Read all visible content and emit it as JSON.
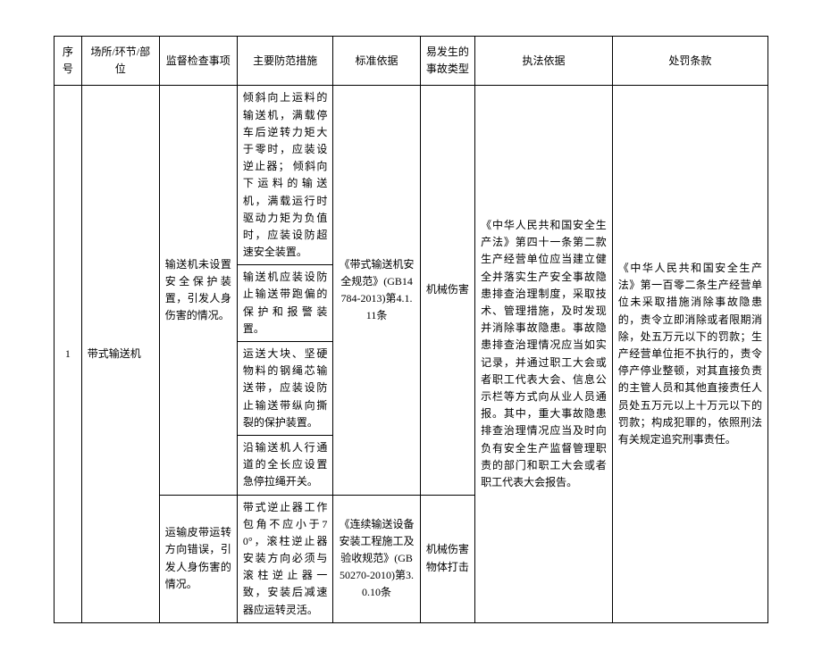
{
  "headers": {
    "seq": "序号",
    "place": "场所/环节/部位",
    "inspect": "监督检查事项",
    "measure": "主要防范措施",
    "standard": "标准依据",
    "accident": "易发生的事故类型",
    "law": "执法依据",
    "penalty": "处罚条款"
  },
  "row": {
    "seq": "1",
    "place": "带式输送机",
    "inspect1": "输送机未设置安全保护装置，引发人身伤害的情况。",
    "measures1": [
      "倾斜向上运料的输送机，满载停车后逆转力矩大于零时，应装设逆止器；\n倾斜向下运料的输送机，满载运行时驱动力矩为负值时，应装设防超速安全装置。",
      "输送机应装设防止输送带跑偏的保护和报警装置。",
      "运送大块、坚硬物料的钢绳芯输送带，应装设防止输送带纵向撕裂的保护装置。",
      "沿输送机人行通道的全长应设置急停拉绳开关。"
    ],
    "standard1": "《带式输送机安全规范》(GB14784-2013)第4.1.11条",
    "accident1": "机械伤害",
    "inspect2": "运输皮带运转方向错误，引发人身伤害的情况。",
    "measure2": "带式逆止器工作包角不应小于70°，滚柱逆止器安装方向必须与滚柱逆止器一致，安装后减速器应运转灵活。",
    "standard2": "《连续输送设备安装工程施工及验收规范》(GB50270-2010)第3.0.10条",
    "accident2": "机械伤害物体打击",
    "law": "《中华人民共和国安全生产法》第四十一条第二款生产经营单位应当建立健全并落实生产安全事故隐患排查治理制度，采取技术、管理措施，及时发现并消除事故隐患。事故隐患排查治理情况应当如实记录，并通过职工大会或者职工代表大会、信息公示栏等方式向从业人员通报。其中，重大事故隐患排查治理情况应当及时向负有安全生产监督管理职责的部门和职工大会或者职工代表大会报告。",
    "penalty": "《中华人民共和国安全生产法》第一百零二条生产经营单位未采取措施消除事故隐患的，责令立即消除或者限期消除，处五万元以下的罚款；生产经营单位拒不执行的，责令停产停业整顿，对其直接负责的主管人员和其他直接责任人员处五万元以上十万元以下的罚款；构成犯罪的，依照刑法有关规定追究刑事责任。"
  }
}
